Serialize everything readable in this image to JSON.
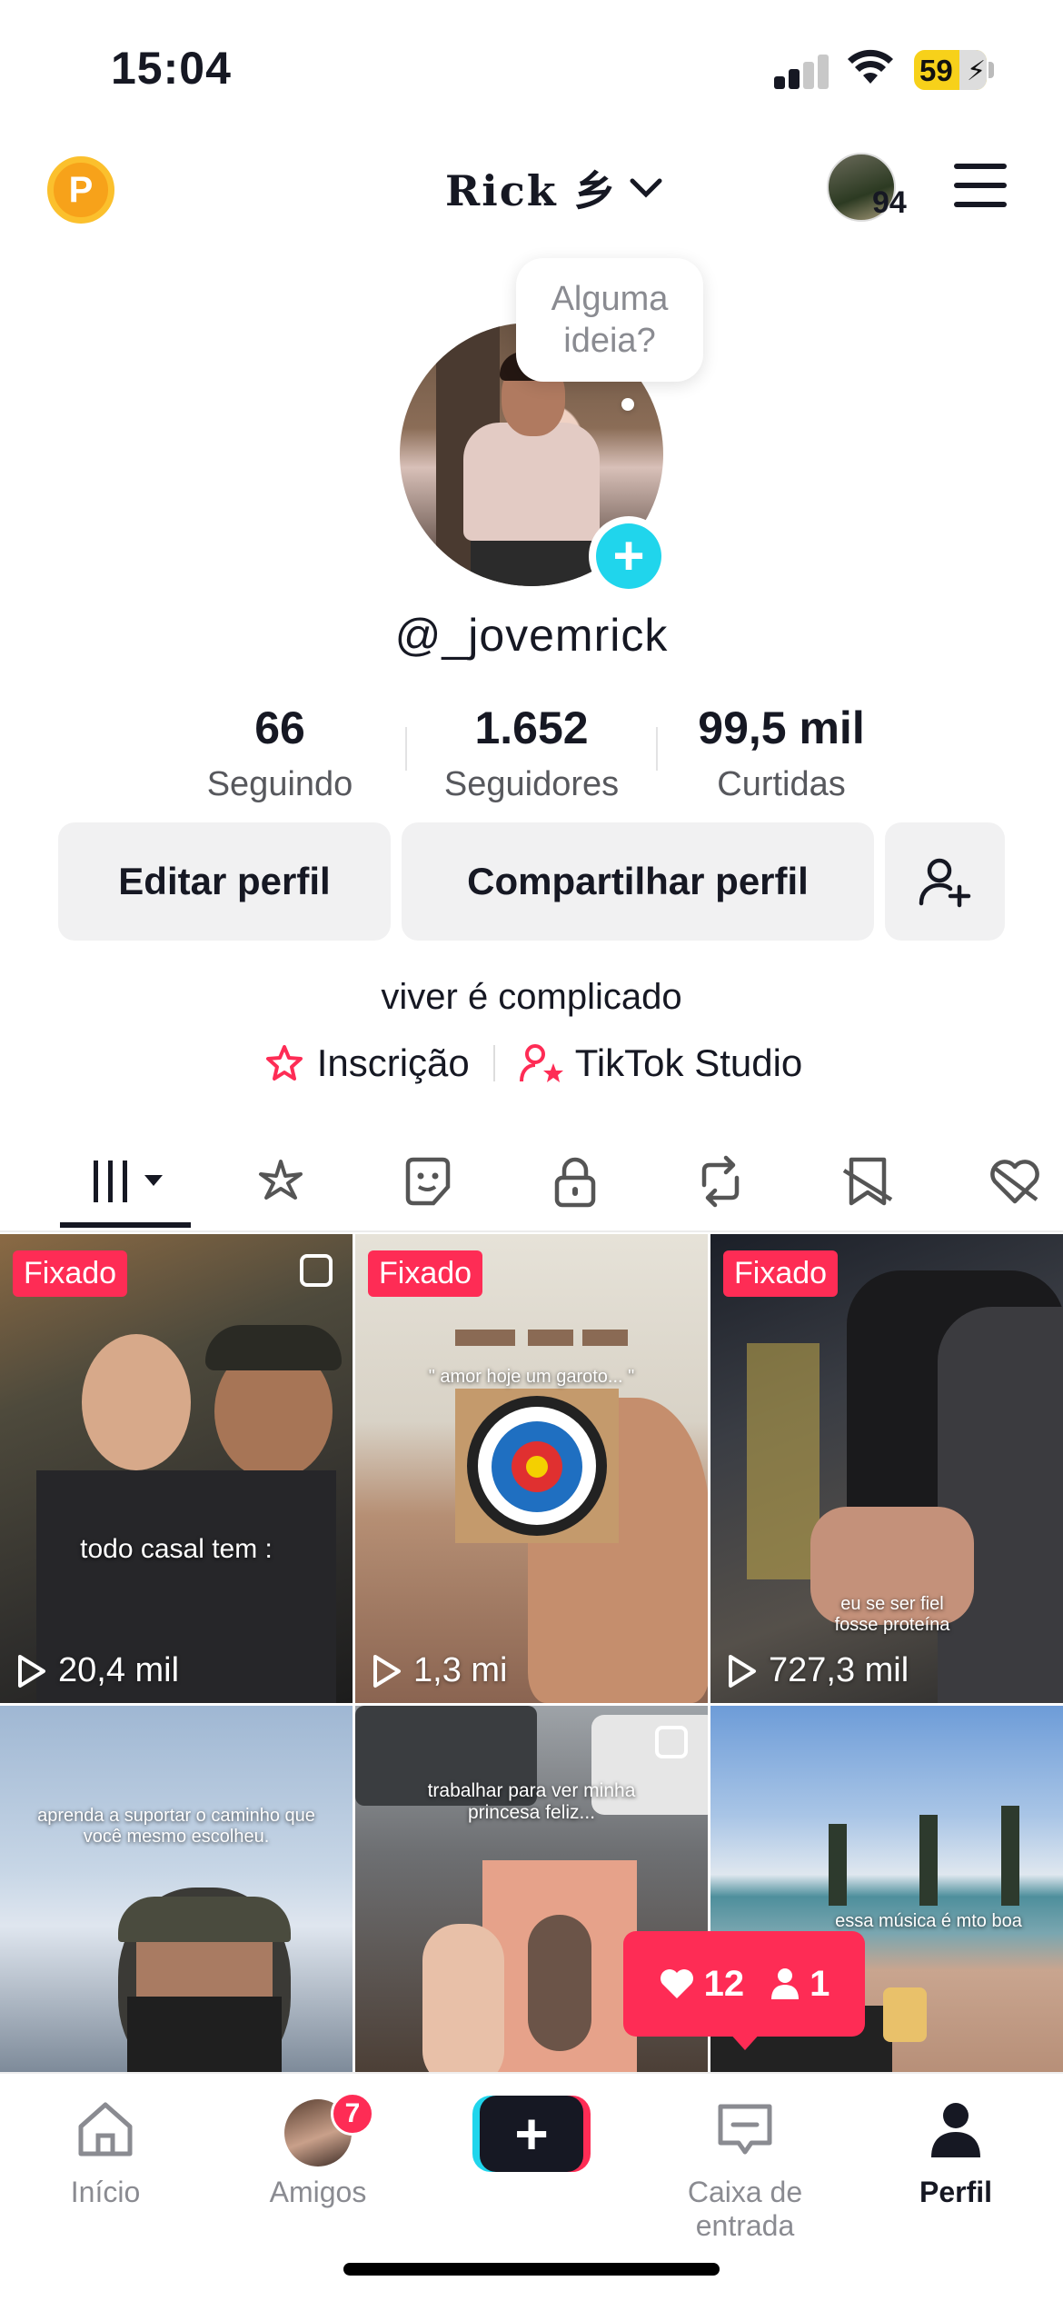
{
  "status_bar": {
    "time": "15:04",
    "battery": "59"
  },
  "header": {
    "username": "Rick 乡",
    "friends_count": "94"
  },
  "profile": {
    "tooltip": "Alguma ideia?",
    "handle": "@_jovemrick",
    "stats": [
      {
        "value": "66",
        "label": "Seguindo"
      },
      {
        "value": "1.652",
        "label": "Seguidores"
      },
      {
        "value": "99,5 mil",
        "label": "Curtidas"
      }
    ],
    "edit_button": "Editar perfil",
    "share_button": "Compartilhar perfil",
    "bio": "viver é complicado",
    "links": [
      "Inscrição",
      "TikTok Studio"
    ]
  },
  "tabs": [
    "videos",
    "favorites-spark",
    "stickers",
    "private",
    "reposts",
    "hidden",
    "liked"
  ],
  "videos": [
    {
      "pinned": "Fixado",
      "caption": "todo casal tem :",
      "views": "20,4 mil"
    },
    {
      "pinned": "Fixado",
      "caption": "\" amor hoje um garoto... \"",
      "views": "1,3 mi"
    },
    {
      "pinned": "Fixado",
      "caption": "eu se ser fiel fosse proteína",
      "views": "727,3 mil"
    },
    {
      "caption": "aprenda a suportar o caminho que você mesmo escolheu."
    },
    {
      "caption": "trabalhar para ver minha princesa feliz..."
    },
    {
      "caption": "essa música é mto boa"
    }
  ],
  "activity_popup": {
    "likes": "12",
    "followers": "1"
  },
  "bottom_nav": {
    "home": "Início",
    "friends": "Amigos",
    "friends_badge": "7",
    "inbox": "Caixa de entrada",
    "profile": "Perfil"
  }
}
